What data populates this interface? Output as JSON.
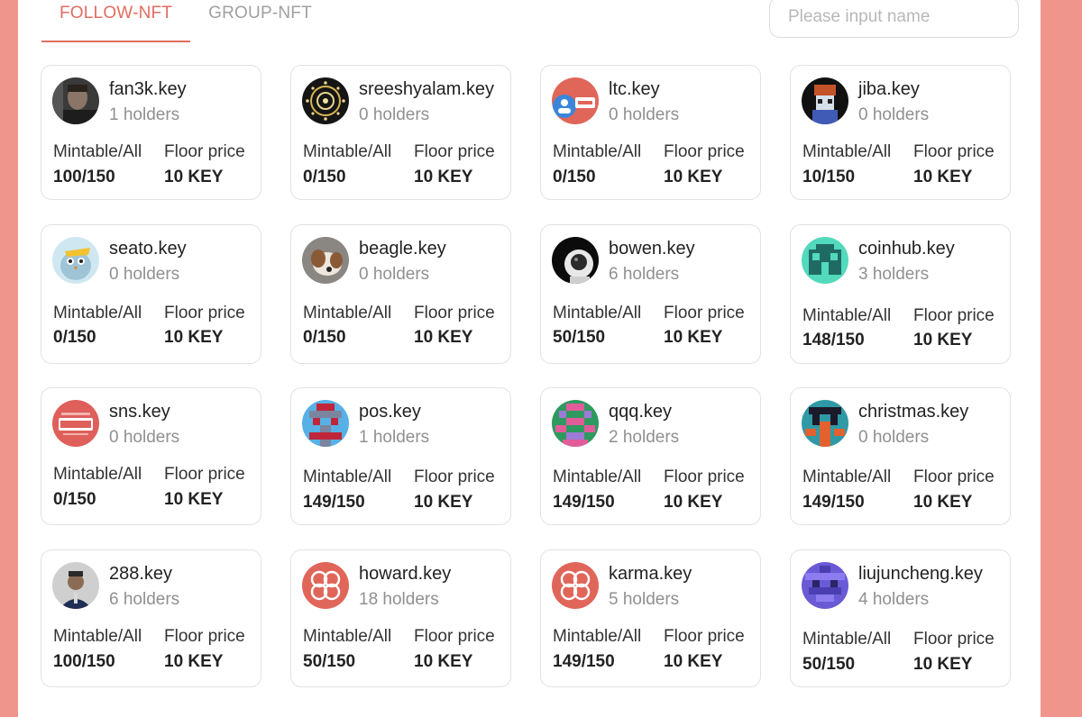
{
  "tabs": [
    {
      "label": "FOLLOW-NFT",
      "active": true
    },
    {
      "label": "GROUP-NFT",
      "active": false
    }
  ],
  "search": {
    "placeholder": "Please input name",
    "icon": "search-icon"
  },
  "labels": {
    "mintable": "Mintable/All",
    "floor": "Floor price"
  },
  "accent_color": "#e06c60",
  "cards": [
    {
      "name": "fan3k.key",
      "holders": "1 holders",
      "mintable": "100/150",
      "floor": "10 KEY",
      "avatar": "portrait-dark"
    },
    {
      "name": "sreeshyalam.key",
      "holders": "0 holders",
      "mintable": "0/150",
      "floor": "10 KEY",
      "avatar": "mandala"
    },
    {
      "name": "ltc.key",
      "holders": "0 holders",
      "mintable": "0/150",
      "floor": "10 KEY",
      "avatar": "sns-badge"
    },
    {
      "name": "jiba.key",
      "holders": "0 holders",
      "mintable": "10/150",
      "floor": "10 KEY",
      "avatar": "pixel-character"
    },
    {
      "name": "seato.key",
      "holders": "0 holders",
      "mintable": "0/150",
      "floor": "10 KEY",
      "avatar": "cartoon-bird"
    },
    {
      "name": "beagle.key",
      "holders": "0 holders",
      "mintable": "0/150",
      "floor": "10 KEY",
      "avatar": "dog-photo"
    },
    {
      "name": "bowen.key",
      "holders": "6 holders",
      "mintable": "50/150",
      "floor": "10 KEY",
      "avatar": "astronaut"
    },
    {
      "name": "coinhub.key",
      "holders": "3 holders",
      "mintable": "148/150",
      "floor": "10 KEY",
      "avatar": "pixel-teal"
    },
    {
      "name": "sns.key",
      "holders": "0 holders",
      "mintable": "0/150",
      "floor": "10 KEY",
      "avatar": "sns-logo"
    },
    {
      "name": "pos.key",
      "holders": "1 holders",
      "mintable": "149/150",
      "floor": "10 KEY",
      "avatar": "pixel-blue-red"
    },
    {
      "name": "qqq.key",
      "holders": "2 holders",
      "mintable": "149/150",
      "floor": "10 KEY",
      "avatar": "pixel-pink-green"
    },
    {
      "name": "christmas.key",
      "holders": "0 holders",
      "mintable": "149/150",
      "floor": "10 KEY",
      "avatar": "pixel-orange-teal"
    },
    {
      "name": "288.key",
      "holders": "6 holders",
      "mintable": "100/150",
      "floor": "10 KEY",
      "avatar": "portrait-suit"
    },
    {
      "name": "howard.key",
      "holders": "18 holders",
      "mintable": "50/150",
      "floor": "10 KEY",
      "avatar": "coral-logo"
    },
    {
      "name": "karma.key",
      "holders": "5 holders",
      "mintable": "149/150",
      "floor": "10 KEY",
      "avatar": "coral-logo"
    },
    {
      "name": "liujuncheng.key",
      "holders": "4 holders",
      "mintable": "50/150",
      "floor": "10 KEY",
      "avatar": "pixel-purple"
    }
  ]
}
